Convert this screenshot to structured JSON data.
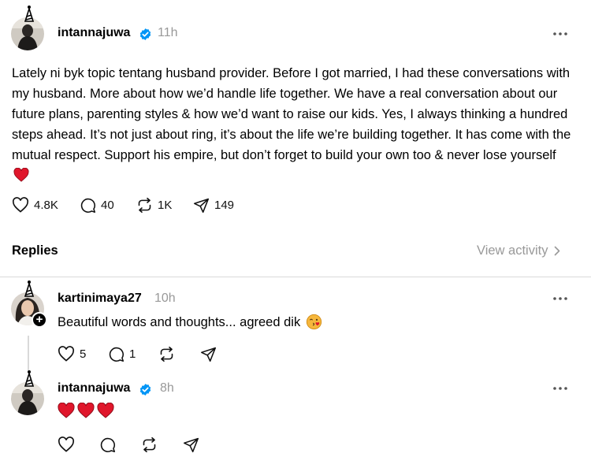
{
  "post": {
    "username": "intannajuwa",
    "time": "11h",
    "text": "Lately ni byk topic tentang husband provider. Before I got married, I had these conversations with my husband. More about how we’d handle life together. We have a real conversation about our future plans, parenting styles & how we’d want to raise our kids. Yes, I always thinking a hundred steps ahead. It’s not just about ring, it’s about the life we’re building together. It has come with the mutual respect. Support his empire, but don’t forget to build your own too & never lose yourself",
    "likes": "4.8K",
    "comments": "40",
    "reposts": "1K",
    "shares": "149"
  },
  "replies_header": {
    "label": "Replies",
    "view_activity": "View activity"
  },
  "replies": [
    {
      "username": "kartinimaya27",
      "time": "10h",
      "text": "Beautiful words and thoughts... agreed dik",
      "likes": "5",
      "comments": "1"
    },
    {
      "username": "intannajuwa",
      "time": "8h",
      "text": ""
    }
  ],
  "colors": {
    "verified": "#0095f6",
    "heart": "#e0162b",
    "muted": "#999999"
  }
}
